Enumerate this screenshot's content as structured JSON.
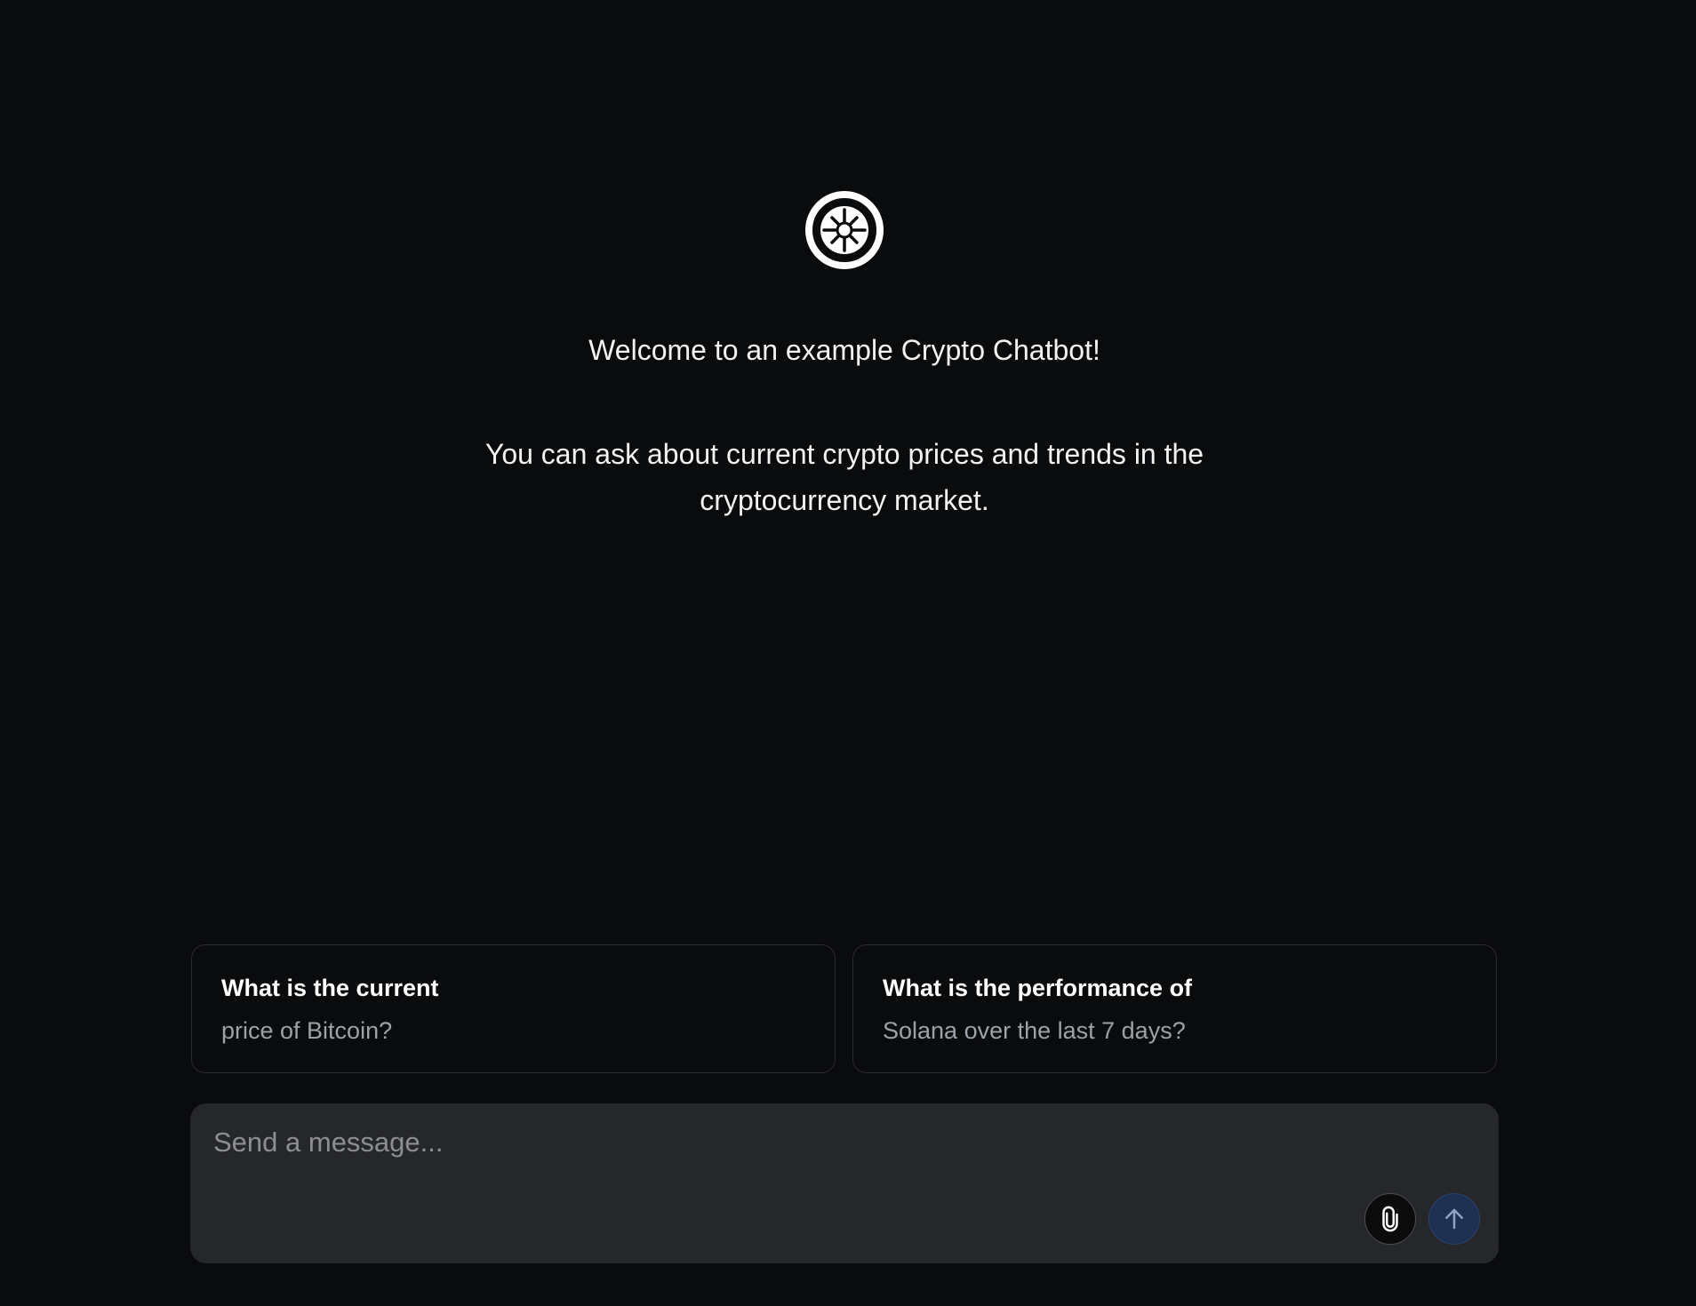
{
  "hero": {
    "logo_icon": "crypto-wheel-logo-icon",
    "welcome": "Welcome to an example Crypto Chatbot!",
    "intro": "You can ask about current crypto prices and trends in the cryptocurrency market."
  },
  "suggestions": [
    {
      "title": "What is the current",
      "subtitle": "price of Bitcoin?"
    },
    {
      "title": "What is the performance of",
      "subtitle": "Solana over the last 7 days?"
    }
  ],
  "composer": {
    "placeholder": "Send a message...",
    "value": "",
    "attach_icon": "paperclip-icon",
    "send_icon": "arrow-up-icon"
  },
  "colors": {
    "background": "#0a0b0d",
    "composer_bg": "#26272a",
    "send_button": "#1f3152",
    "card_border": "#2b2c30"
  }
}
